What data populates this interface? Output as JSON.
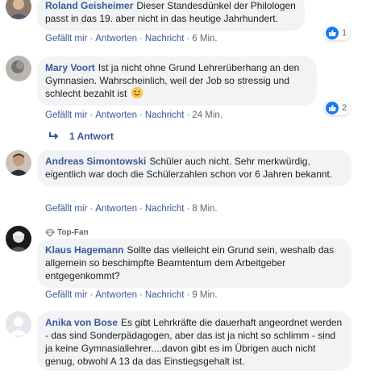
{
  "colors": {
    "link": "#385898",
    "bubble": "#f2f3f5",
    "meta": "#606770",
    "like": "#1877f2"
  },
  "comments": [
    {
      "author": "Roland Geisheimer",
      "text": "Dieser Standesdünkel der Philologen passt in das 19. aber nicht in das heutige Jahrhundert.",
      "actions": {
        "like": "Gefällt mir",
        "reply": "Antworten",
        "message": "Nachricht",
        "time": "6 Min."
      },
      "reactions": {
        "icon": "like-icon",
        "count": "1"
      }
    },
    {
      "author": "Mary Voort",
      "text": "Ist ja nicht ohne Grund Lehrerüberhang an den Gymnasien. Wahrscheinlich, weil der Job so stressig und schlecht bezahlt ist",
      "emoji": "wink-emoji",
      "actions": {
        "like": "Gefällt mir",
        "reply": "Antworten",
        "message": "Nachricht",
        "time": "24 Min."
      },
      "reactions": {
        "icon": "like-icon",
        "count": "2"
      },
      "replies_link": "1 Antwort"
    },
    {
      "author": "Andreas Simontowski",
      "text": "Schüler auch nicht. Sehr merkwürdig, eigentlich war doch die Schülerzahlen schon vor 6 Jahren bekannt.",
      "actions": {
        "like": "Gefällt mir",
        "reply": "Antworten",
        "message": "Nachricht",
        "time": "8 Min."
      }
    },
    {
      "badge": "Top-Fan",
      "author": "Klaus Hagemann",
      "text": "Sollte das vielleicht ein Grund sein, weshalb das allgemein so beschimpfte Beamtentum dem Arbeitgeber entgegenkommt?",
      "actions": {
        "like": "Gefällt mir",
        "reply": "Antworten",
        "message": "Nachricht",
        "time": "9 Min."
      }
    },
    {
      "author": "Anika von Bose",
      "text": "Es gibt Lehrkräfte die dauerhaft angeordnet werden - das sind Sonderpädagogen, aber das ist ja nicht so schlimm - sind ja keine Gymnasiallehrer....davon gibt es im Übrigen auch nicht genug, obwohl A 13 da das Einstiegsgehalt ist."
    }
  ]
}
